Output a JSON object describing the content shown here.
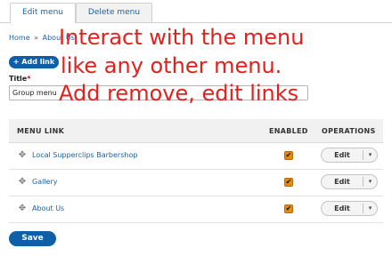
{
  "tabs": [
    {
      "label": "Edit menu",
      "active": true
    },
    {
      "label": "Delete menu",
      "active": false
    }
  ],
  "breadcrumb": {
    "items": [
      "Home",
      "About Us"
    ],
    "separator": "»"
  },
  "add_link_label": "+ Add link",
  "title_field": {
    "label": "Title",
    "required_marker": "*",
    "value": "Group menu"
  },
  "overlay_text": {
    "line1": "Interact with the menu",
    "line2": "like any other menu.",
    "line3": "Add remove, edit links",
    "color": "#e0211d"
  },
  "table": {
    "headers": {
      "link": "MENU LINK",
      "enabled": "ENABLED",
      "operations": "OPERATIONS"
    },
    "rows": [
      {
        "link": "Local Supperclips Barbershop",
        "enabled": true,
        "operation": "Edit"
      },
      {
        "link": "Gallery",
        "enabled": true,
        "operation": "Edit"
      },
      {
        "link": "About Us",
        "enabled": true,
        "operation": "Edit"
      }
    ]
  },
  "icons": {
    "drag": "drag-handle-icon",
    "checkbox": "checkmark-icon",
    "dropdown": "chevron-down-icon"
  },
  "check_glyph": "✔",
  "dropdown_glyph": "▾",
  "drag_glyph": "✥",
  "save_label": "Save",
  "colors": {
    "link": "#1b62a8",
    "primary_button": "#0f5ea8",
    "checkbox": "#e28a12"
  }
}
